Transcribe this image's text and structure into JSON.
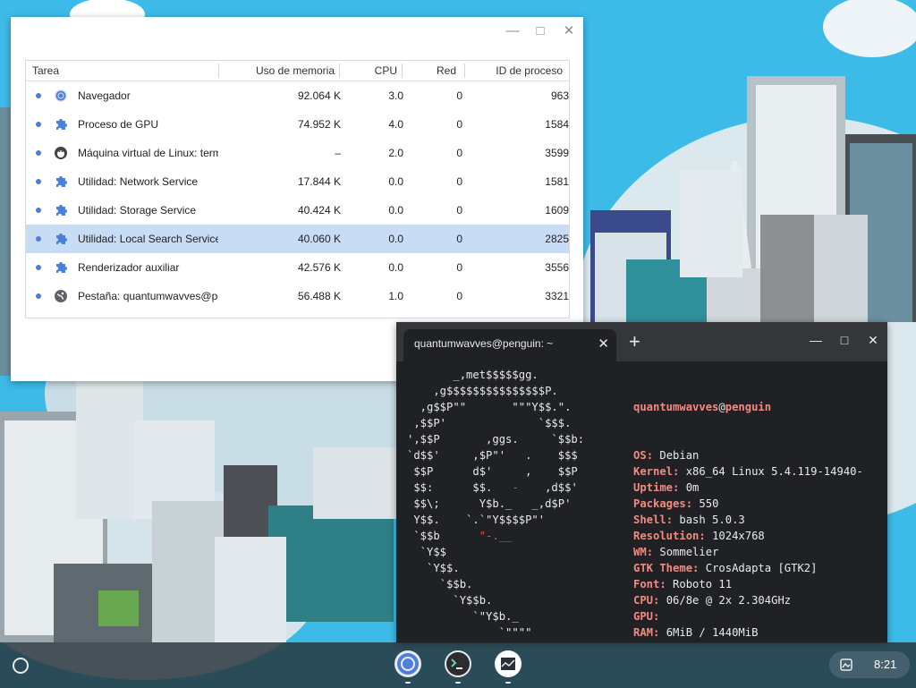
{
  "task_manager": {
    "columns": [
      "Tarea",
      "Uso de memoria",
      "CPU",
      "Red",
      "ID de proceso"
    ],
    "rows": [
      {
        "icon": "chrome-icon",
        "name": "Navegador",
        "memory": "92.064 K",
        "cpu": "3.0",
        "network": "0",
        "pid": "963",
        "selected": false
      },
      {
        "icon": "puzzle-icon",
        "name": "Proceso de GPU",
        "memory": "74.952 K",
        "cpu": "4.0",
        "network": "0",
        "pid": "1584",
        "selected": false
      },
      {
        "icon": "linux-vm-icon",
        "name": "Máquina virtual de Linux: termina",
        "memory": "–",
        "cpu": "2.0",
        "network": "0",
        "pid": "3599",
        "selected": false
      },
      {
        "icon": "puzzle-icon",
        "name": "Utilidad: Network Service",
        "memory": "17.844 K",
        "cpu": "0.0",
        "network": "0",
        "pid": "1581",
        "selected": false
      },
      {
        "icon": "puzzle-icon",
        "name": "Utilidad: Storage Service",
        "memory": "40.424 K",
        "cpu": "0.0",
        "network": "0",
        "pid": "1609",
        "selected": false
      },
      {
        "icon": "puzzle-icon",
        "name": "Utilidad: Local Search Service",
        "memory": "40.060 K",
        "cpu": "0.0",
        "network": "0",
        "pid": "2825",
        "selected": true
      },
      {
        "icon": "puzzle-icon",
        "name": "Renderizador auxiliar",
        "memory": "42.576 K",
        "cpu": "0.0",
        "network": "0",
        "pid": "3556",
        "selected": false
      },
      {
        "icon": "globe-icon",
        "name": "Pestaña: quantumwavves@penguin",
        "memory": "56.488 K",
        "cpu": "1.0",
        "network": "0",
        "pid": "3321",
        "selected": false
      }
    ]
  },
  "terminal": {
    "tab_title": "quantumwavves@penguin: ~",
    "logo_lines": [
      "       _,met$$$$$gg.",
      "    ,g$$$$$$$$$$$$$$$P.",
      "  ,g$$P\"\"       \"\"\"Y$$.\".",
      " ,$$P'              `$$$.",
      "',$$P       ,ggs.     `$$b:",
      "`d$$'     ,$P\"'   .    $$$",
      " $$P      d$'     ,    $$P",
      " $$:      $$.   -    ,d$$'",
      " $$\\;      Y$b._   _,d$P'",
      " Y$$.    `.`\"Y$$$$P\"'",
      " `$$b      \"-.__",
      "  `Y$$",
      "   `Y$$.",
      "     `$$b.",
      "       `Y$$b.",
      "          `\"Y$b._",
      "              `\"\"\"\""
    ],
    "user": "quantumwavves",
    "at": "@",
    "host": "penguin",
    "info": [
      {
        "key": "OS",
        "value": "Debian"
      },
      {
        "key": "Kernel",
        "value": "x86_64 Linux 5.4.119-14940-"
      },
      {
        "key": "Uptime",
        "value": "0m"
      },
      {
        "key": "Packages",
        "value": "550"
      },
      {
        "key": "Shell",
        "value": "bash 5.0.3"
      },
      {
        "key": "Resolution",
        "value": "1024x768"
      },
      {
        "key": "WM",
        "value": "Sommelier"
      },
      {
        "key": "GTK Theme",
        "value": "CrosAdapta [GTK2]"
      },
      {
        "key": "Font",
        "value": "Roboto 11"
      },
      {
        "key": "CPU",
        "value": "06/8e @ 2x 2.304GHz"
      },
      {
        "key": "GPU",
        "value": ""
      },
      {
        "key": "RAM",
        "value": "6MiB / 1440MiB"
      }
    ]
  },
  "shelf": {
    "apps": [
      "chrome-icon",
      "terminal-icon",
      "task-manager-icon"
    ],
    "time": "8:21"
  },
  "colors": {
    "sky": "#3dbbe8",
    "selection": "#c9dcf6",
    "accent": "#4b82d9",
    "terminal_bg": "#202124",
    "terminal_key": "#f28b82"
  }
}
